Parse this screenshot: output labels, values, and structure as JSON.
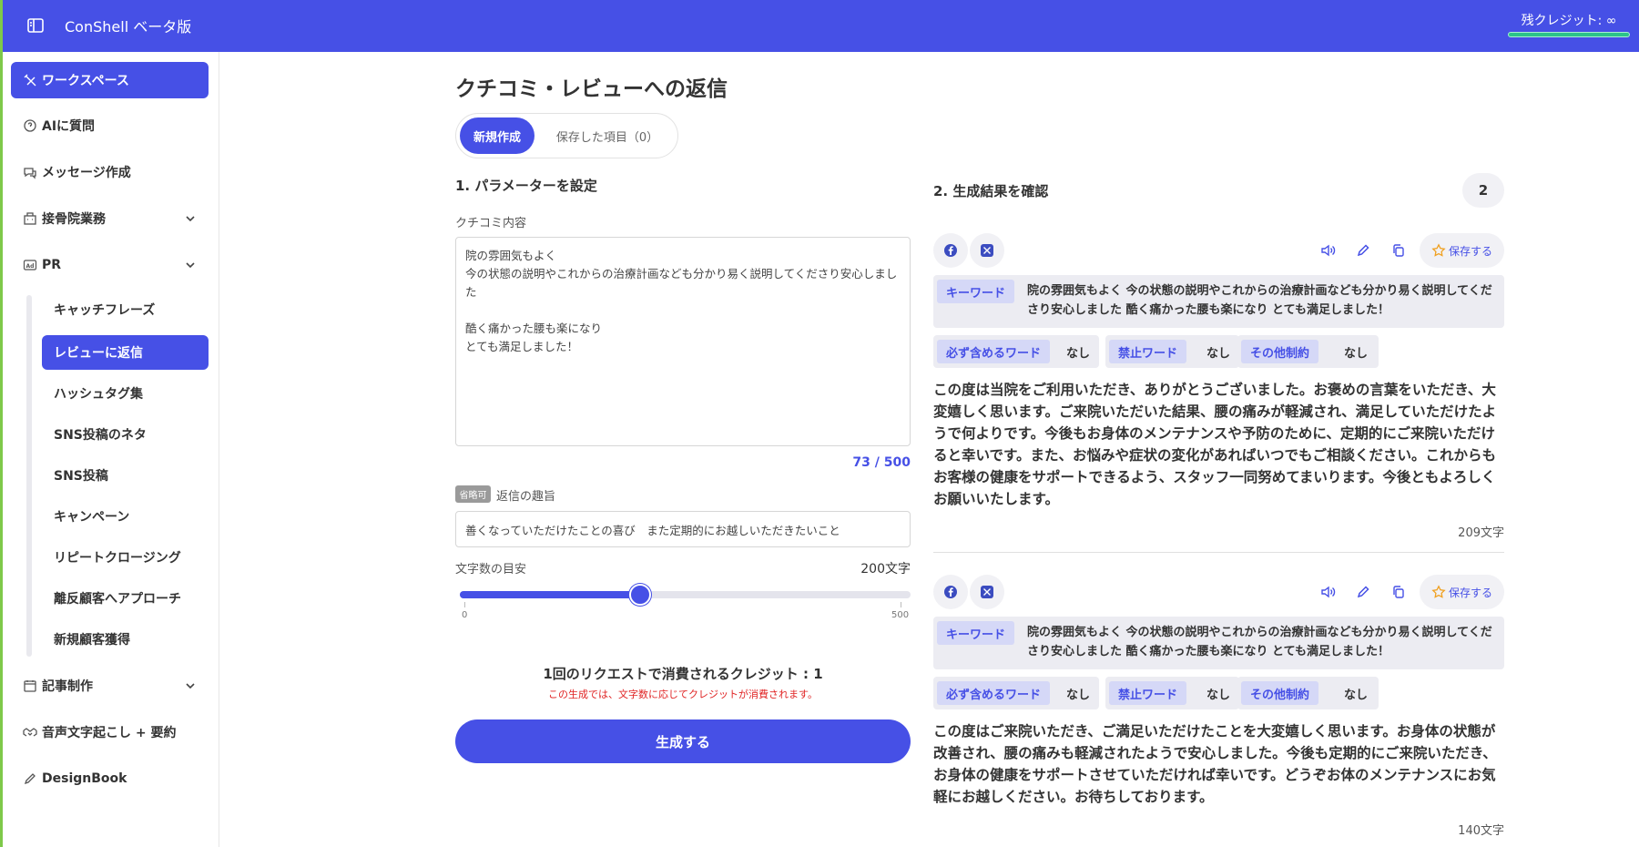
{
  "header": {
    "title": "ConShell ベータ版",
    "credits": "残クレジット: ∞"
  },
  "sidebar": {
    "items": [
      {
        "label": "ワークスペース"
      },
      {
        "label": "AIに質問"
      },
      {
        "label": "メッセージ作成"
      },
      {
        "label": "接骨院業務"
      },
      {
        "label": "PR"
      },
      {
        "label": "記事制作"
      },
      {
        "label": "音声文字起こし + 要約"
      },
      {
        "label": "DesignBook"
      }
    ],
    "pr_items": [
      {
        "label": "キャッチフレーズ"
      },
      {
        "label": "レビューに返信"
      },
      {
        "label": "ハッシュタグ集"
      },
      {
        "label": "SNS投稿のネタ"
      },
      {
        "label": "SNS投稿"
      },
      {
        "label": "キャンペーン"
      },
      {
        "label": "リピートクロージング"
      },
      {
        "label": "離反顧客へアプローチ"
      },
      {
        "label": "新規顧客獲得"
      }
    ]
  },
  "main": {
    "title": "クチコミ・レビューへの返信",
    "tabs": {
      "new": "新規作成",
      "saved": "保存した項目（0）"
    },
    "params_title": "1. パラメーターを設定",
    "review_label": "クチコミ内容",
    "review_text": "院の雰囲気もよく\n今の状態の説明やこれからの治療計画なども分かり易く説明してくださり安心しました\n\n酷く痛かった腰も楽になり\nとても満足しました！",
    "review_counter": "73 / 500",
    "optional_badge": "省略可",
    "intent_label": "返信の趣旨",
    "intent_value": "善くなっていただけたことの喜び　また定期的にお越しいただきたいこと",
    "length_label": "文字数の目安",
    "length_value": "200文字",
    "slider": {
      "min": "0",
      "max": "500",
      "value": 200
    },
    "credit_note": "1回のリクエストで消費されるクレジット : 1",
    "credit_warning": "この生成では、文字数に応じてクレジットが消費されます。",
    "generate_label": "生成する"
  },
  "results": {
    "title": "2. 生成結果を確認",
    "count": "2",
    "save_label": "保存する",
    "keyword_tag": "キーワード",
    "must_tag": "必ず含めるワード",
    "forbidden_tag": "禁止ワード",
    "other_tag": "その他制約",
    "items": [
      {
        "keywords": "院の雰囲気もよく 今の状態の説明やこれからの治療計画なども分かり易く説明してくださり安心しました 酷く痛かった腰も楽になり とても満足しました！",
        "must": "なし",
        "forbidden": "なし",
        "other": "なし",
        "text": "この度は当院をご利用いただき、ありがとうございました。お褒めの言葉をいただき、大変嬉しく思います。ご来院いただいた結果、腰の痛みが軽減され、満足していただけたようで何よりです。今後もお身体のメンテナンスや予防のために、定期的にご来院いただけると幸いです。また、お悩みや症状の変化があればいつでもご相談ください。これからもお客様の健康をサポートできるよう、スタッフ一同努めてまいります。今後ともよろしくお願いいたします。",
        "char_count": "209文字"
      },
      {
        "keywords": "院の雰囲気もよく 今の状態の説明やこれからの治療計画なども分かり易く説明してくださり安心しました 酷く痛かった腰も楽になり とても満足しました！",
        "must": "なし",
        "forbidden": "なし",
        "other": "なし",
        "text": "この度はご来院いただき、ご満足いただけたことを大変嬉しく思います。お身体の状態が改善され、腰の痛みも軽減されたようで安心しました。今後も定期的にご来院いただき、お身体の健康をサポートさせていただければ幸いです。どうぞお体のメンテナンスにお気軽にお越しください。お待ちしております。",
        "char_count": "140文字"
      }
    ]
  },
  "colors": {
    "brand": "#4650e6",
    "warning": "#e02424",
    "sidebar_accent": "#7ec94a"
  }
}
